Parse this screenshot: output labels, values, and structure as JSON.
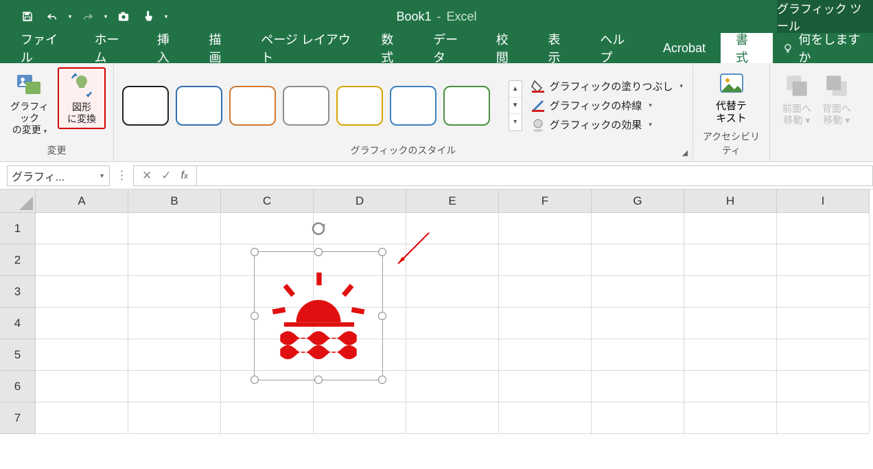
{
  "title": {
    "file": "Book1",
    "sep": "-",
    "app": "Excel",
    "contextual": "グラフィック ツール"
  },
  "qat": {
    "save": "save",
    "undo": "undo",
    "redo": "redo",
    "camera": "camera",
    "touch": "touch"
  },
  "tabs": {
    "file": "ファイル",
    "home": "ホーム",
    "insert": "挿入",
    "draw": "描画",
    "pagelayout": "ページ レイアウト",
    "formulas": "数式",
    "data": "データ",
    "review": "校閲",
    "view": "表示",
    "help": "ヘルプ",
    "acrobat": "Acrobat",
    "format": "書式",
    "tellme": "何をしますか"
  },
  "ribbon": {
    "change_group": "変更",
    "change_graphic": "グラフィック\nの変更",
    "convert_shape": "図形\nに変換",
    "styles_group": "グラフィックのスタイル",
    "fill": "グラフィックの塗りつぶし",
    "outline": "グラフィックの枠線",
    "effects": "グラフィックの効果",
    "accessibility_group": "アクセシビリティ",
    "alt_text": "代替テ\nキスト",
    "bring_forward": "前面へ\n移動",
    "send_backward": "背面へ\n移動"
  },
  "style_colors": [
    "#222222",
    "#2f6fb0",
    "#d07830",
    "#8c8c8c",
    "#d9a400",
    "#3a7fbd",
    "#4a8f3f"
  ],
  "namebox": "グラフィ...",
  "columns": [
    "A",
    "B",
    "C",
    "D",
    "E",
    "F",
    "G",
    "H",
    "I"
  ],
  "rows": [
    "1",
    "2",
    "3",
    "4",
    "5",
    "6",
    "7"
  ]
}
